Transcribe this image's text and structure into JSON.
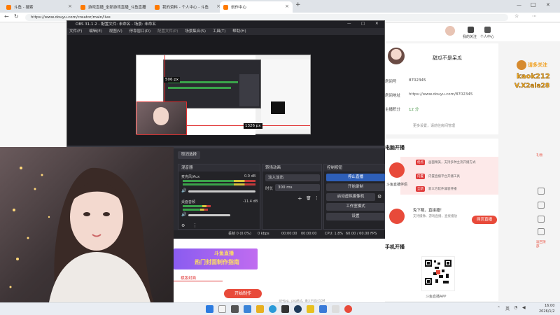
{
  "browser": {
    "tabs": [
      {
        "title": "斗鱼 - 搜索"
      },
      {
        "title": "游戏直播_全部游戏直播_斗鱼直播"
      },
      {
        "title": "我的资料 - 个人中心 - 斗鱼"
      },
      {
        "title": "创作中心"
      }
    ],
    "new_tab": "+",
    "url": "https://www.douyu.com/creator/main/live",
    "win_min": "—",
    "win_max": "□",
    "win_close": "✕"
  },
  "douyu_header": {
    "upload_label": "我的关注",
    "msg_label": "个人中心",
    "cast_label": "消息"
  },
  "profile": {
    "name": "甜瓜不是呆瓜",
    "rows": [
      {
        "label": "房间号",
        "value": "8702345"
      },
      {
        "label": "房间地址",
        "value": "https://www.douyu.com/8702345"
      },
      {
        "label": "主播积分",
        "value": "12 分"
      }
    ],
    "more_link": "更多设置，请前往房间管理"
  },
  "pc_section": {
    "title": "电脑开播",
    "obs_tag1": "优点",
    "obs_tag1_text": "画面精美，支持多种主流开播方式",
    "obs_tag2": "内置",
    "obs_tag2_text": "内置直播平台开播工具",
    "obs_tag3": "全新",
    "obs_tag3_text": "新三方软件兼容开播",
    "tool_name": "斗鱼直播伴侣",
    "tool2_title": "免下载，直接播！",
    "tool2_text": "支持摄像、游戏直播，直接播放",
    "open_btn": "网页直播"
  },
  "mobile_section": {
    "title": "手机开播",
    "qr_label": "斗鱼直播APP"
  },
  "promo": {
    "line1": "请多关注",
    "line2": "kaok212",
    "line3": "V.X2ala28"
  },
  "right_sidebar": {
    "item1": "礼物",
    "item2": "返回顶部"
  },
  "obs": {
    "title": "OBS 31.1.2 - 配置文件: 未命名 - 场景: 未命名",
    "menu": [
      "文件(F)",
      "编辑(E)",
      "视图(V)",
      "停靠窗口(D)",
      "配置文件(P)",
      "场景集合(S)",
      "工具(T)",
      "帮助(H)"
    ],
    "preview_size1": "506 px",
    "preview_size2": "1326 px",
    "cancel_select": "取消选择",
    "mixer_title": "混音器",
    "track1_name": "麦克风/Aux",
    "track1_db": "0.0 dB",
    "track2_name": "桌面音频",
    "track2_db": "-11.4 dB",
    "transition_title": "转场动画",
    "transition_value": "淡入淡出",
    "duration_label": "时长",
    "duration_value": "300 ms",
    "controls_title": "控制按钮",
    "btn_stop": "停止直播",
    "btn_record": "开始录制",
    "btn_vcam": "启动虚拟摄像机",
    "btn_studio": "工作室模式",
    "btn_settings": "设置",
    "status_dropped": "丢帧 0 (0.0%)",
    "status_kbps": "0 kbps",
    "status_time": "00:00:00",
    "status_rec": "00:00:00",
    "status_cpu": "CPU: 1.8%",
    "status_fps": "60.00 / 60.00 FPS"
  },
  "editor": {
    "banner_line1": "斗鱼直播",
    "banner_line2": "热门封面制作指南",
    "cover_tab": "横版封面",
    "make_btn": "开始制作",
    "hint": "支持jpg、png格式，最大不超过10M"
  },
  "taskbar": {
    "lang": "英",
    "time": "16:00",
    "date": "2026/1/2"
  }
}
